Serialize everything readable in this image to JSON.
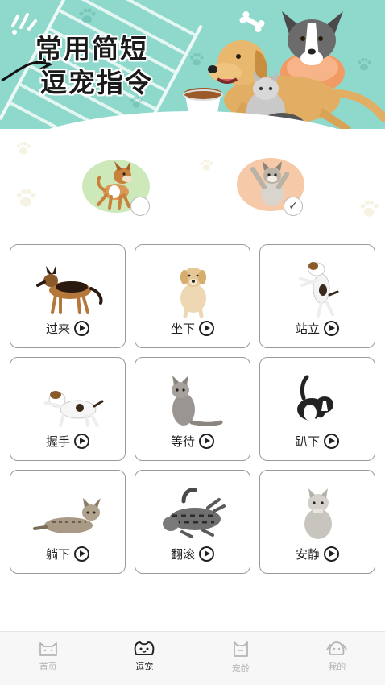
{
  "banner": {
    "title_line1": "常用简短",
    "title_line2": "逗宠指令"
  },
  "pet_choice": {
    "options": [
      {
        "id": "dog",
        "selected": false
      },
      {
        "id": "cat",
        "selected": true
      }
    ],
    "check_mark": "✓"
  },
  "commands": [
    {
      "label": "过来",
      "icon": "german-shepherd"
    },
    {
      "label": "坐下",
      "icon": "sitting-golden-puppy"
    },
    {
      "label": "站立",
      "icon": "jack-russell-standing"
    },
    {
      "label": "握手",
      "icon": "jack-russell-paw"
    },
    {
      "label": "等待",
      "icon": "sitting-grey-cat"
    },
    {
      "label": "趴下",
      "icon": "border-collie-lying"
    },
    {
      "label": "躺下",
      "icon": "tabby-cat-lying"
    },
    {
      "label": "翻滚",
      "icon": "tabby-cat-rolling"
    },
    {
      "label": "安静",
      "icon": "sitting-silver-cat"
    }
  ],
  "tabs": [
    {
      "label": "首页",
      "icon": "cat-face-icon",
      "active": false
    },
    {
      "label": "逗宠",
      "icon": "paw-face-icon",
      "active": true
    },
    {
      "label": "宠龄",
      "icon": "cat-tag-icon",
      "active": false
    },
    {
      "label": "我的",
      "icon": "dog-face-icon",
      "active": false
    }
  ],
  "colors": {
    "banner_bg": "#8fd9cc",
    "dog_choice_bg": "#cde9b9",
    "cat_choice_bg": "#f6c9a8",
    "card_border": "#9a9a9a",
    "tab_active": "#222222",
    "tab_inactive": "#b5b5b5"
  }
}
